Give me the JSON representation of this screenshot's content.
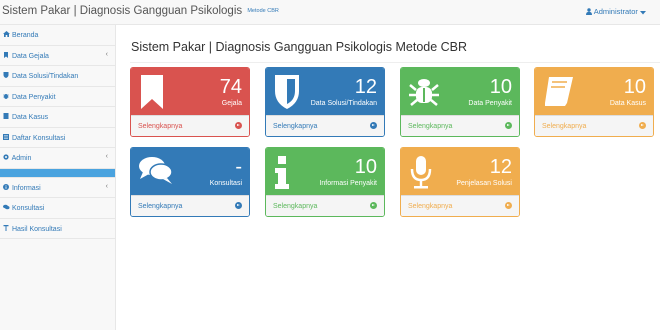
{
  "topbar": {
    "title": "Sistem Pakar | Diagnosis Gangguan Psikologis",
    "subtitle": "Metode CBR",
    "user_label": "Administrator",
    "user_icon": "user-icon",
    "dropdown_icon": "caret-down-icon"
  },
  "sidebar": {
    "items": [
      {
        "label": "Beranda",
        "icon": "home-icon"
      },
      {
        "label": "Data Gejala",
        "icon": "bookmark-icon",
        "chevron": "‹"
      },
      {
        "label": "Data Solusi/Tindakan",
        "icon": "shield-icon"
      },
      {
        "label": "Data Penyakit",
        "icon": "bug-icon"
      },
      {
        "label": "Data Kasus",
        "icon": "book-icon"
      },
      {
        "label": "Daftar Konsultasi",
        "icon": "list-icon"
      },
      {
        "label": "Admin",
        "icon": "gear-icon",
        "chevron": "‹"
      },
      {
        "label": "",
        "icon": ""
      },
      {
        "label": "Informasi",
        "icon": "info-icon",
        "chevron": "‹"
      },
      {
        "label": "Konsultasi",
        "icon": "comments-icon"
      },
      {
        "label": "Hasil Konsultasi",
        "icon": "pushpin-icon"
      }
    ]
  },
  "main": {
    "title": "Sistem Pakar | Diagnosis Gangguan Psikologis Metode CBR",
    "cards": [
      {
        "value": "74",
        "label": "Gejala",
        "link": "Selengkapnya",
        "color": "#d9534f",
        "icon": "bookmark-icon"
      },
      {
        "value": "12",
        "label": "Data Solusi/Tindakan",
        "link": "Selengkapnya",
        "color": "#337ab7",
        "icon": "shield-icon"
      },
      {
        "value": "10",
        "label": "Data Penyakit",
        "link": "Selengkapnya",
        "color": "#5cb85c",
        "icon": "bug-icon"
      },
      {
        "value": "10",
        "label": "Data Kasus",
        "link": "Selengkapnya",
        "color": "#f0ad4e",
        "icon": "book-icon"
      },
      {
        "value": "-",
        "label": "Konsultasi",
        "link": "Selengkapnya",
        "color": "#337ab7",
        "icon": "comments-icon"
      },
      {
        "value": "10",
        "label": "Informasi Penyakit",
        "link": "Selengkapnya",
        "color": "#5cb85c",
        "icon": "info-icon"
      },
      {
        "value": "12",
        "label": "Penjelasan Solusi",
        "link": "Selengkapnya",
        "color": "#f0ad4e",
        "icon": "microphone-icon"
      }
    ]
  }
}
